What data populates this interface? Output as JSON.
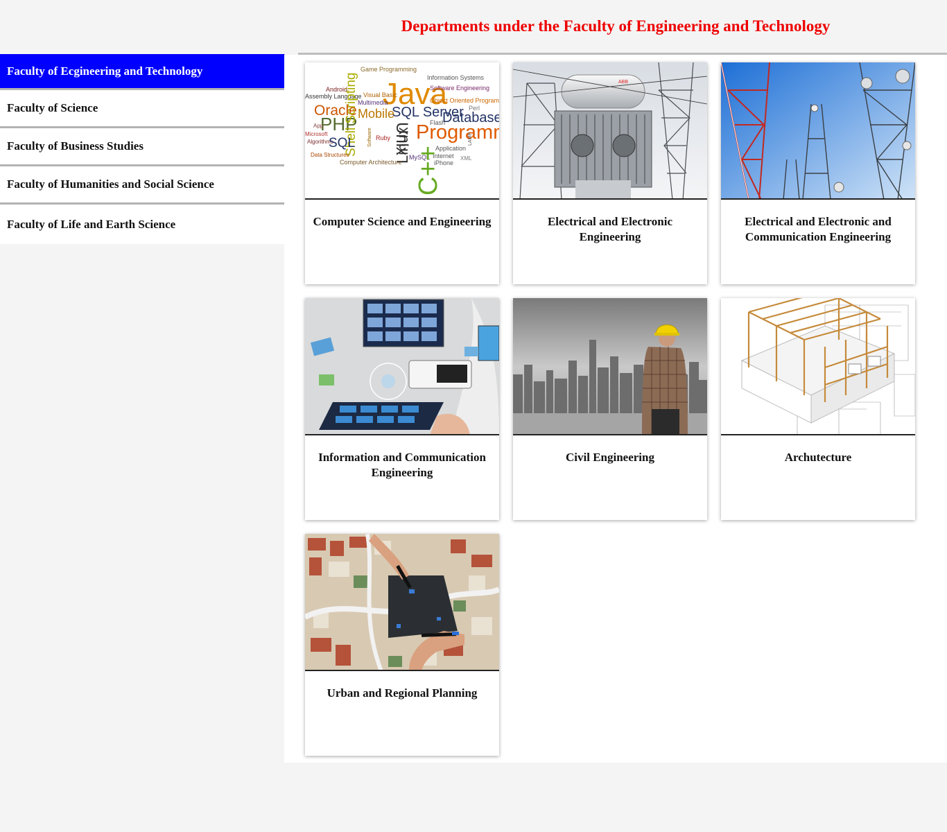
{
  "header": {
    "title": "Departments under the Faculty of Engineering and Technology",
    "title_color": "#ee0000"
  },
  "sidebar": {
    "active_color": "#0000ff",
    "items": [
      {
        "label": "Faculty of Ecgineering and Technology",
        "active": true
      },
      {
        "label": "Faculty of Science",
        "active": false
      },
      {
        "label": "Faculty of Business Studies",
        "active": false
      },
      {
        "label": "Faculty of Humanities and Social Science",
        "active": false
      },
      {
        "label": "Faculty of Life and Earth Science",
        "active": false
      }
    ]
  },
  "departments": [
    {
      "label": "Computer Science and Engineering",
      "image": "programming-word-cloud"
    },
    {
      "label": "Electrical and Electronic Engineering",
      "image": "power-substation"
    },
    {
      "label": "Electrical and Electronic and Communication Engineering",
      "image": "telecom-towers"
    },
    {
      "label": "Information and Communication Engineering",
      "image": "digital-media-tablet"
    },
    {
      "label": "Civil Engineering",
      "image": "engineer-city-skyline"
    },
    {
      "label": "Archutecture",
      "image": "house-frame-blueprint"
    },
    {
      "label": "Urban and Regional Planning",
      "image": "city-planning-map"
    }
  ],
  "word_cloud": [
    "Game Programming",
    "Information Systems",
    "Android",
    "Java",
    "Software Engineering",
    "Assembly Language",
    "Visual Basic",
    "Multimedia",
    "Object Oriented Programming",
    "Perl",
    "Oracle",
    "SQL Server",
    "PHP",
    "Shell Scripting",
    "Mobile",
    "Database",
    "App",
    "Unix",
    "Linux",
    "Flash",
    "Programming",
    "Microsoft",
    "Ruby",
    "Algorithms",
    "SQL",
    "Software",
    "Data Structures",
    "MySQL",
    "Application",
    "Internet",
    "Computer Architecture",
    "iPhone",
    "XML",
    "LAMP",
    "C++"
  ]
}
